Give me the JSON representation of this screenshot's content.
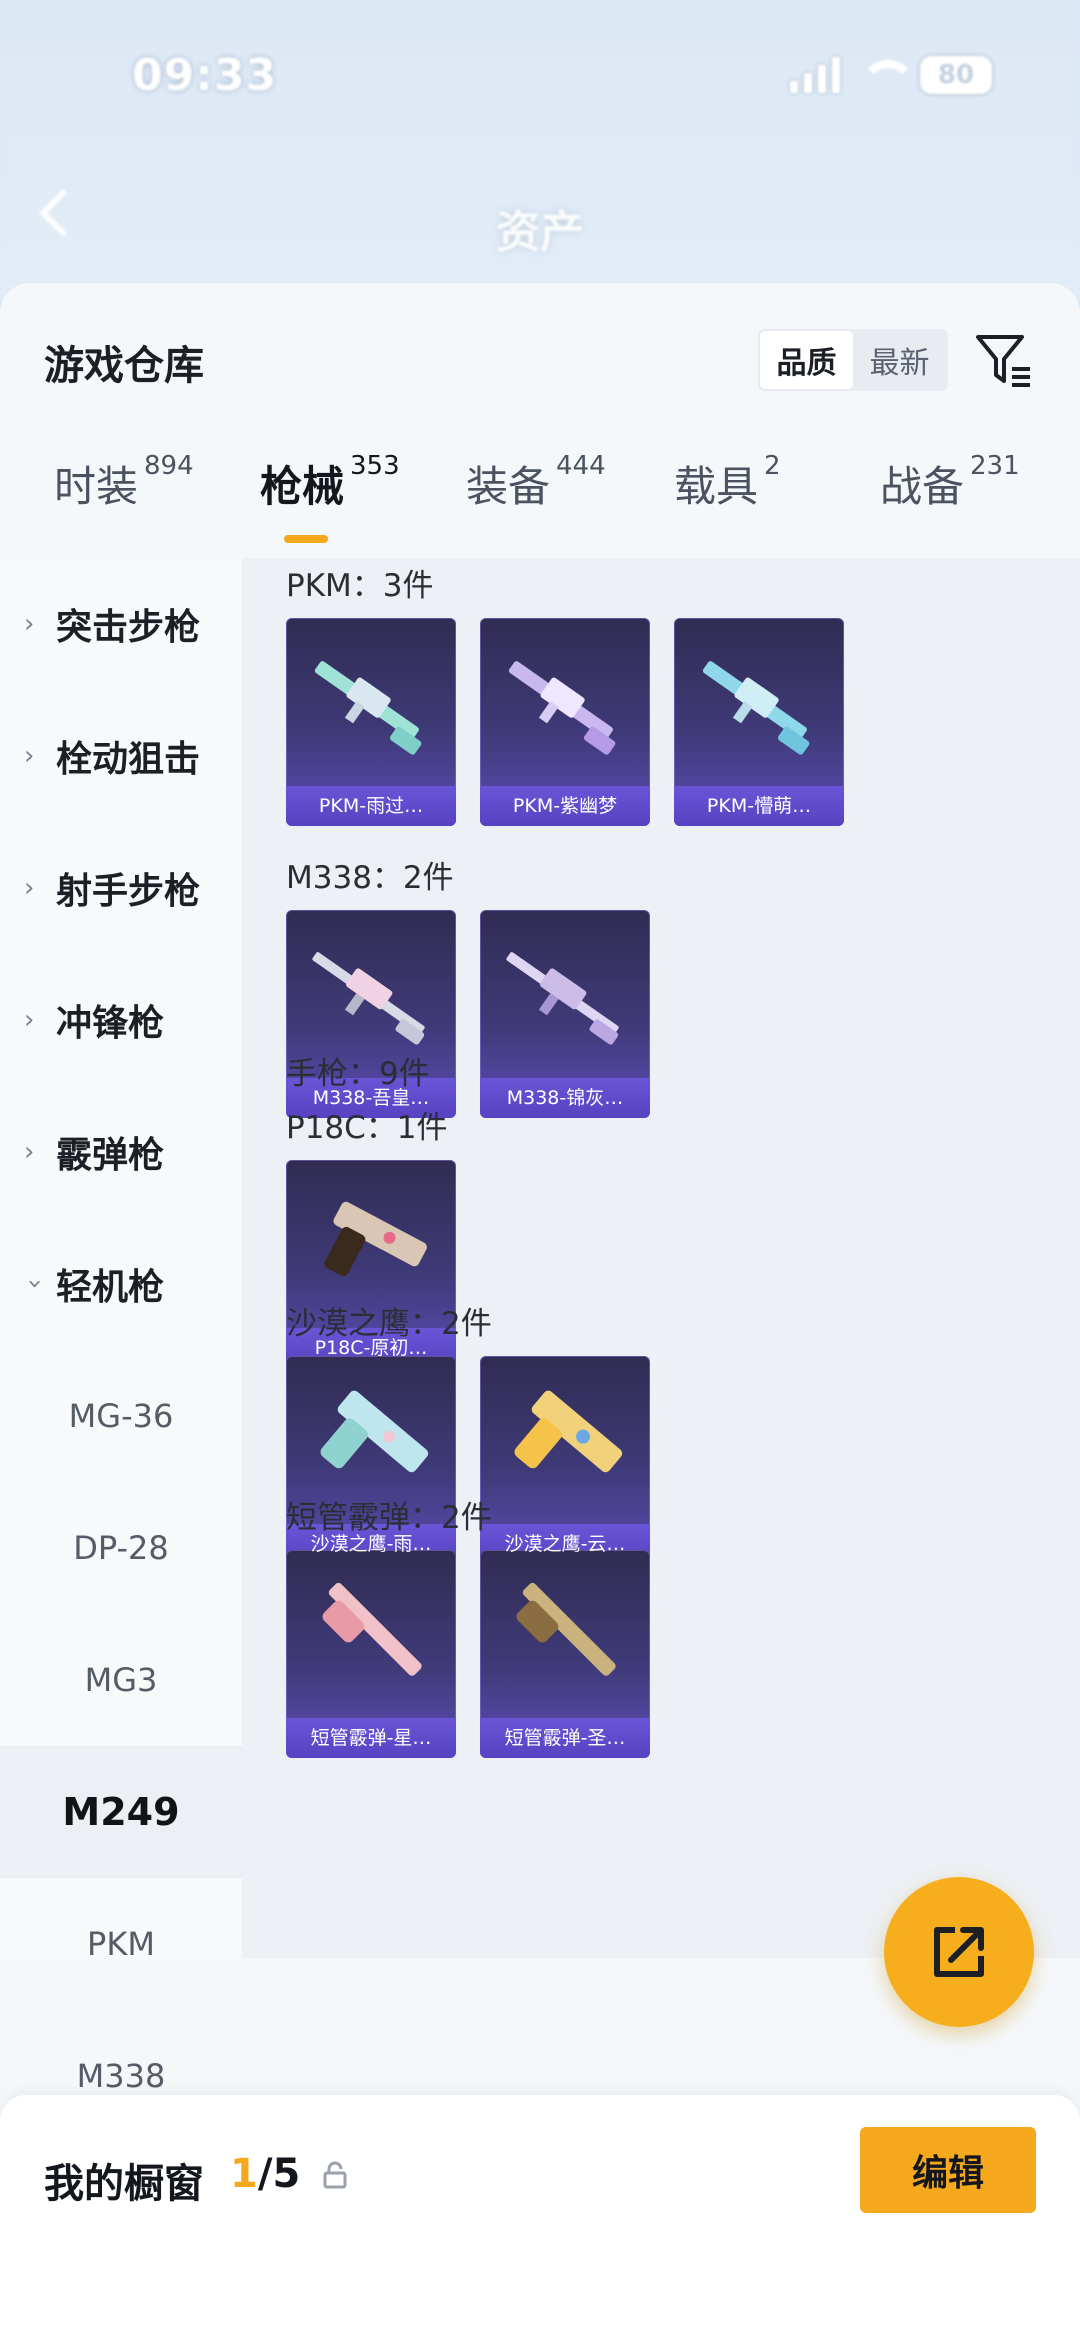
{
  "status_bar": {
    "time": "09:33",
    "battery": "80"
  },
  "header": {
    "title": "资产"
  },
  "sheet": {
    "title": "游戏仓库",
    "sort": {
      "options": [
        "品质",
        "最新"
      ],
      "active": "品质"
    }
  },
  "tabs": [
    {
      "label": "时装",
      "count": "894"
    },
    {
      "label": "枪械",
      "count": "353"
    },
    {
      "label": "装备",
      "count": "444"
    },
    {
      "label": "载具",
      "count": "2"
    },
    {
      "label": "战备",
      "count": "231"
    }
  ],
  "sidebar": {
    "categories": [
      "突击步枪",
      "栓动狙击",
      "射手步枪",
      "冲锋枪",
      "霰弹枪",
      "轻机枪"
    ],
    "expanded": "轻机枪",
    "sub_items": [
      "MG-36",
      "DP-28",
      "MG3",
      "M249",
      "PKM",
      "M338"
    ],
    "selected": "M249"
  },
  "groups": [
    {
      "label": "PKM：3件",
      "items": [
        "PKM-雨过…",
        "PKM-紫幽梦",
        "PKM-懵萌…"
      ]
    },
    {
      "label": "M338：2件",
      "items": [
        "M338-吾皇…",
        "M338-锦灰…"
      ]
    },
    {
      "label": "手枪：9件",
      "items": []
    },
    {
      "label": "P18C：1件",
      "items": [
        "P18C-原初…"
      ]
    },
    {
      "label": "沙漠之鹰：2件",
      "items": [
        "沙漠之鹰-雨…",
        "沙漠之鹰-云…"
      ]
    },
    {
      "label": "短管霰弹：2件",
      "items": [
        "短管霰弹-星…",
        "短管霰弹-圣…"
      ]
    }
  ],
  "showcase": {
    "title": "我的橱窗",
    "current": "1",
    "total": "/5",
    "edit_label": "编辑"
  },
  "colors": {
    "accent": "#f5a81c",
    "card_bg": "#3f3a78",
    "card_label_bg": "#5742c2"
  }
}
